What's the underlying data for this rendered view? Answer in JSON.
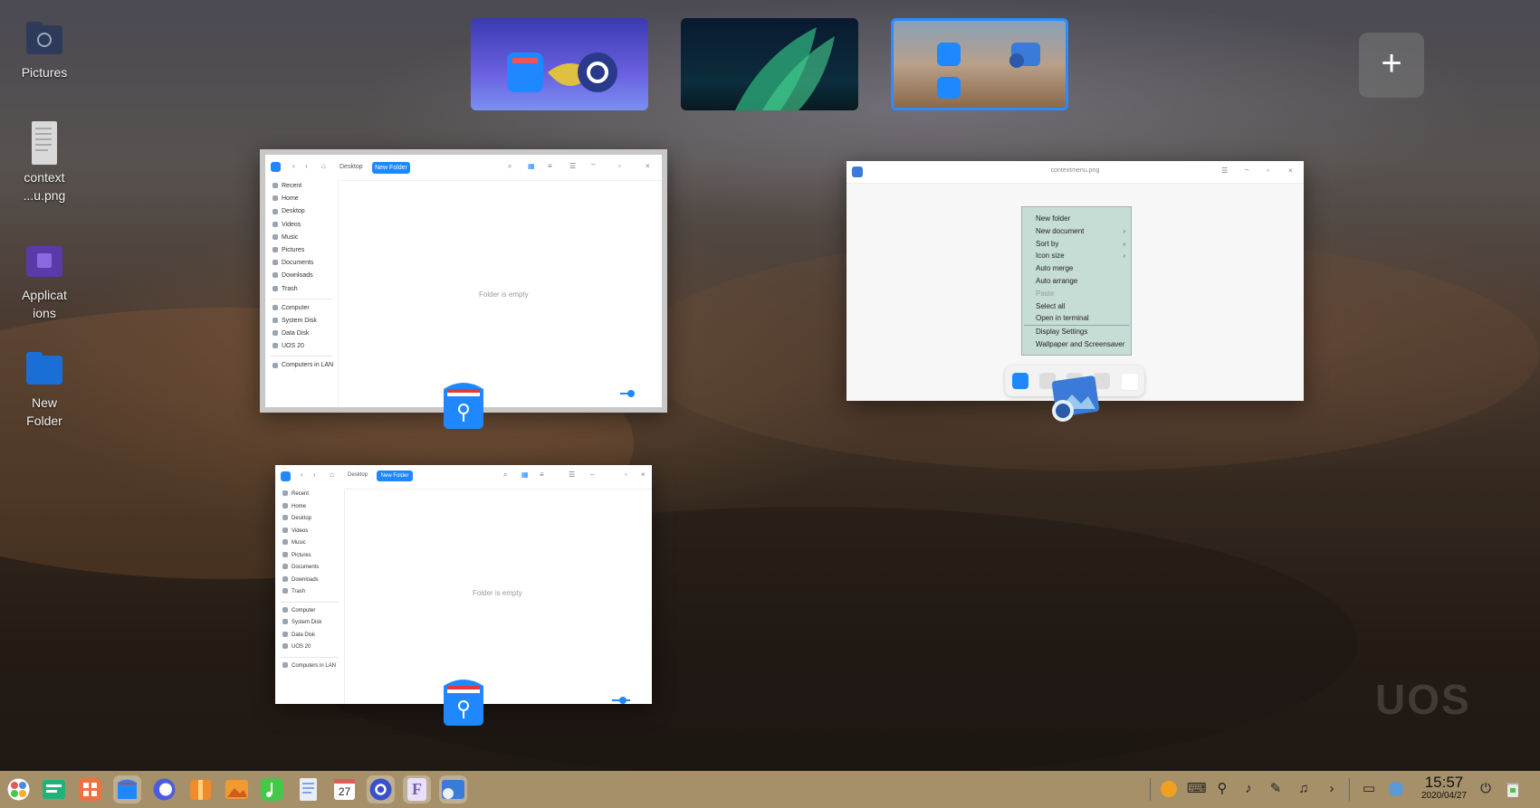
{
  "desktop": {
    "icons": [
      {
        "label": "Pictures"
      },
      {
        "label": "context\n...u.png"
      },
      {
        "label": "Applicat\nions"
      },
      {
        "label": "New\nFolder"
      }
    ],
    "watermark": "UOS"
  },
  "workspaces": {
    "count": 3,
    "active_index": 2,
    "add_label": "+"
  },
  "file_manager": {
    "breadcrumb": "Desktop",
    "new_folder_label": "New Folder",
    "empty_text": "Folder is empty",
    "sidebar": [
      {
        "label": "Recent"
      },
      {
        "label": "Home"
      },
      {
        "label": "Desktop"
      },
      {
        "label": "Videos"
      },
      {
        "label": "Music"
      },
      {
        "label": "Pictures"
      },
      {
        "label": "Documents"
      },
      {
        "label": "Downloads"
      },
      {
        "label": "Trash"
      },
      {
        "label": "Computer"
      },
      {
        "label": "System Disk"
      },
      {
        "label": "Data Disk"
      },
      {
        "label": "UOS 20"
      },
      {
        "label": "Computers in LAN"
      }
    ]
  },
  "image_viewer": {
    "title": "contextmenu.png",
    "context_menu": [
      {
        "label": "New folder",
        "arrow": ""
      },
      {
        "label": "New document",
        "arrow": "›"
      },
      {
        "label": "Sort by",
        "arrow": "›"
      },
      {
        "label": "Icon size",
        "arrow": "›"
      },
      {
        "label": "Auto merge",
        "arrow": ""
      },
      {
        "label": "Auto arrange",
        "arrow": ""
      },
      {
        "label": "Paste",
        "arrow": ""
      },
      {
        "label": "Select all",
        "arrow": ""
      },
      {
        "label": "Open in terminal",
        "arrow": ""
      },
      {
        "label": "Display Settings",
        "arrow": ""
      },
      {
        "label": "Wallpaper and Screensaver",
        "arrow": ""
      }
    ]
  },
  "taskbar": {
    "apps": [
      {
        "icon": "launcher-icon",
        "color": "#e05a5a"
      },
      {
        "icon": "multitask-view-icon",
        "color": "#1fb37a"
      },
      {
        "icon": "app-store-icon",
        "color": "#f07040"
      },
      {
        "icon": "file-manager-icon",
        "color": "#1f88ff"
      },
      {
        "icon": "browser-icon",
        "color": "#4a5ce0"
      },
      {
        "icon": "archive-manager-icon",
        "color": "#f08a2a"
      },
      {
        "icon": "photos-icon",
        "color": "#f09a30"
      },
      {
        "icon": "music-icon",
        "color": "#43c84a"
      },
      {
        "icon": "text-editor-icon",
        "color": "#5a8ee0"
      },
      {
        "icon": "calendar-icon",
        "color": "#ffffff"
      },
      {
        "icon": "control-center-icon",
        "color": "#3a50c8"
      },
      {
        "icon": "font-manager-icon",
        "color": "#7a5ab0"
      },
      {
        "icon": "image-viewer-icon",
        "color": "#3a7ad8"
      }
    ],
    "calendar_day": "27",
    "font_letter": "F",
    "clock_time": "15:57",
    "clock_date": "2020/04/27"
  }
}
